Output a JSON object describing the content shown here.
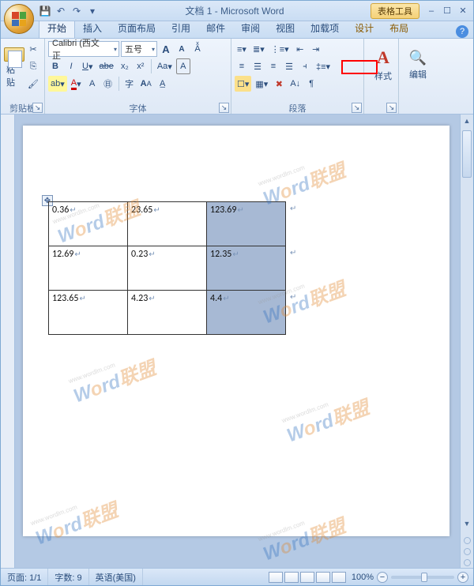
{
  "title": {
    "doc": "文档 1",
    "app": "Microsoft Word",
    "tools_tab": "表格工具"
  },
  "qat": {
    "save": "💾",
    "undo": "↶",
    "redo": "↷",
    "more": "▾"
  },
  "tabs": [
    "开始",
    "插入",
    "页面布局",
    "引用",
    "邮件",
    "审阅",
    "视图",
    "加载项"
  ],
  "context_tabs": [
    "设计",
    "布局"
  ],
  "groups": {
    "clipboard": {
      "paste": "粘贴",
      "label": "剪贴板"
    },
    "font": {
      "name": "Calibri (西文正",
      "size": "五号",
      "grow": "A",
      "shrink": "A",
      "bold": "B",
      "italic": "I",
      "underline": "U",
      "strike": "abe",
      "sub": "x₂",
      "sup": "x²",
      "case": "Aa",
      "clear": "A",
      "hl": "ab",
      "color": "A",
      "charborder": "A",
      "charshade": "A",
      "circled": "㊐",
      "aa": "Aa",
      "phon": "aⁿ",
      "label": "字体"
    },
    "paragraph": {
      "label": "段落"
    },
    "styles": {
      "label": "样式",
      "big": "A"
    },
    "editing": {
      "label": "编辑",
      "find": "🔍"
    }
  },
  "chart_data": {
    "type": "table",
    "rows": [
      [
        "0.36",
        "23.65",
        "123.69"
      ],
      [
        "12.69",
        "0.23",
        "12.35"
      ],
      [
        "123.65",
        "4.23",
        "4.4"
      ]
    ],
    "selected_column_index": 2
  },
  "watermark": {
    "site": "www.wordlm.com",
    "text_en": "Word",
    "text_cn": "联盟"
  },
  "status": {
    "page": "页面: 1/1",
    "words": "字数: 9",
    "lang": "英语(美国)",
    "zoom": "100%"
  },
  "window": {
    "min": "–",
    "max": "☐",
    "close": "✕"
  }
}
